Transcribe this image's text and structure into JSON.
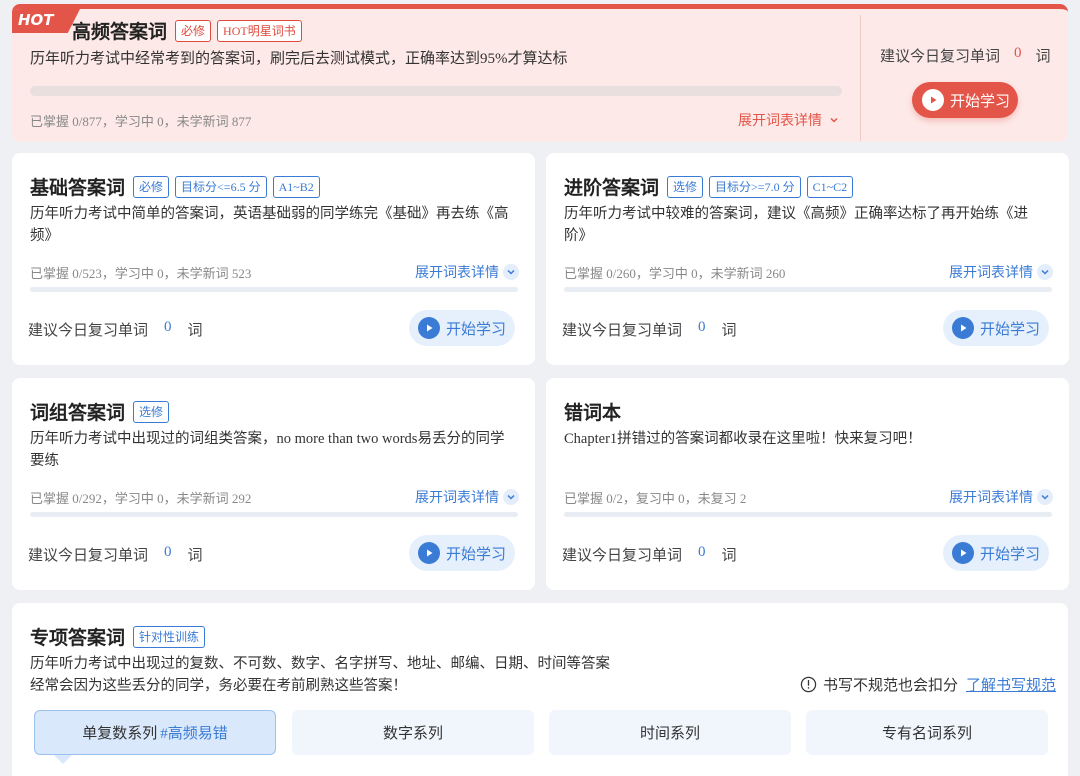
{
  "colors": {
    "hot_red": "#e35548",
    "accent_blue": "#3a7bd5",
    "page_bg": "#eef0f3"
  },
  "hot": {
    "badge": "HOT",
    "title": "高频答案词",
    "tags": [
      "必修",
      "HOT明星词书"
    ],
    "desc": "历年听力考试中经常考到的答案词，刷完后去测试模式，正确率达到95%才算达标",
    "stats": "已掌握 0/877，学习中 0，未学新词 877",
    "progress": 0,
    "expand_label": "展开词表详情",
    "review_prefix": "建议今日复习单词",
    "review_count": "0",
    "review_suffix": "词",
    "start_label": "开始学习"
  },
  "cards": [
    {
      "title": "基础答案词",
      "tags": [
        "必修",
        "目标分<=6.5 分",
        "A1~B2"
      ],
      "desc": "历年听力考试中简单的答案词，英语基础弱的同学练完《基础》再去练《高频》",
      "stats": "已掌握 0/523，学习中 0，未学新词 523",
      "progress": 0,
      "expand_label": "展开词表详情",
      "review_prefix": "建议今日复习单词",
      "review_count": "0",
      "review_suffix": "词",
      "start_label": "开始学习"
    },
    {
      "title": "进阶答案词",
      "tags": [
        "选修",
        "目标分>=7.0 分",
        "C1~C2"
      ],
      "desc": "历年听力考试中较难的答案词，建议《高频》正确率达标了再开始练《进阶》",
      "stats": "已掌握 0/260，学习中 0，未学新词 260",
      "progress": 0,
      "expand_label": "展开词表详情",
      "review_prefix": "建议今日复习单词",
      "review_count": "0",
      "review_suffix": "词",
      "start_label": "开始学习"
    },
    {
      "title": "词组答案词",
      "tags": [
        "选修"
      ],
      "desc": "历年听力考试中出现过的词组类答案，no more than two words易丢分的同学要练",
      "stats": "已掌握 0/292，学习中 0，未学新词 292",
      "progress": 0,
      "expand_label": "展开词表详情",
      "review_prefix": "建议今日复习单词",
      "review_count": "0",
      "review_suffix": "词",
      "start_label": "开始学习"
    },
    {
      "title": "错词本",
      "tags": [],
      "desc": "Chapter1拼错过的答案词都收录在这里啦！快来复习吧！",
      "stats": "已掌握 0/2，复习中 0，未复习 2",
      "progress": 0,
      "expand_label": "展开词表详情",
      "review_prefix": "建议今日复习单词",
      "review_count": "0",
      "review_suffix": "词",
      "start_label": "开始学习"
    }
  ],
  "special": {
    "title": "专项答案词",
    "tag": "针对性训练",
    "desc_line1": "历年听力考试中出现过的复数、不可数、数字、名字拼写、地址、邮编、日期、时间等答案",
    "desc_line2": "经常会因为这些丢分的同学，务必要在考前刷熟这些答案！",
    "hint_text": "书写不规范也会扣分",
    "hint_link": "了解书写规范",
    "tabs": [
      {
        "label": "单复数系列",
        "highlight": "#高频易错"
      },
      {
        "label": "数字系列",
        "highlight": ""
      },
      {
        "label": "时间系列",
        "highlight": ""
      },
      {
        "label": "专有名词系列",
        "highlight": ""
      }
    ]
  }
}
